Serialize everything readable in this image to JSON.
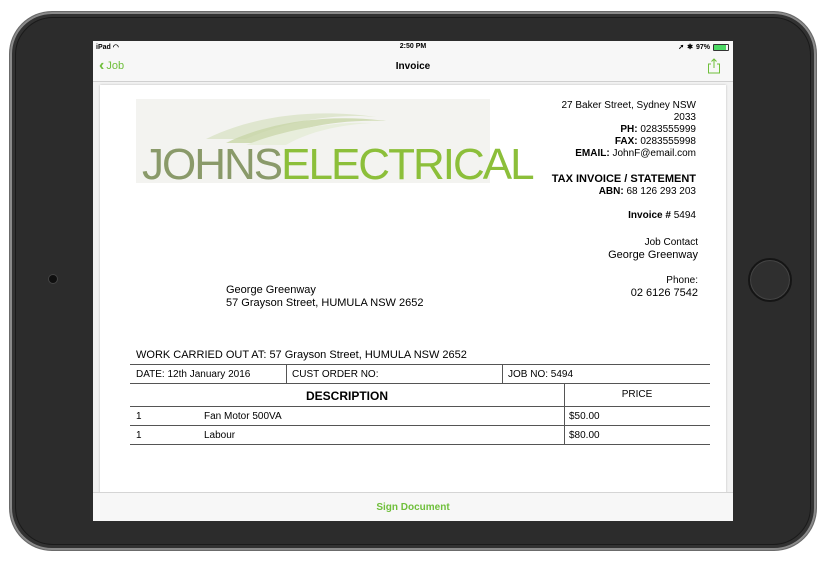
{
  "status_bar": {
    "device": "iPad",
    "time": "2:50 PM",
    "battery": "97%"
  },
  "nav": {
    "back_label": "Job",
    "title": "Invoice"
  },
  "logo": {
    "part1": "JOHNS",
    "part2": "ELECTRICAL",
    "color_part1": "#8a9a6a",
    "color_part2": "#8cbf3a"
  },
  "company": {
    "address_line1": "27 Baker Street, Sydney NSW",
    "address_line2": "2033",
    "ph_label": "PH:",
    "ph": "0283555999",
    "fax_label": "FAX:",
    "fax": "0283555998",
    "email_label": "EMAIL:",
    "email": "JohnF@email.com"
  },
  "invoice": {
    "title": "TAX INVOICE / STATEMENT",
    "abn_label": "ABN:",
    "abn": "68 126 293 203",
    "number_label": "Invoice #",
    "number": "5494",
    "job_contact_label": "Job Contact",
    "job_contact": "George Greenway",
    "phone_label": "Phone:",
    "phone": "02 6126 7542"
  },
  "client": {
    "name": "George Greenway",
    "address": "57 Grayson Street, HUMULA NSW 2652"
  },
  "work_carried_out": "WORK CARRIED OUT AT: 57 Grayson Street, HUMULA NSW 2652",
  "meta_row": {
    "date": "DATE: 12th January 2016",
    "cust_order": "CUST ORDER NO:",
    "job_no": "JOB NO: 5494"
  },
  "table_headers": {
    "description": "DESCRIPTION",
    "price": "PRICE"
  },
  "line_items": [
    {
      "qty": "1",
      "description": "Fan Motor 500VA",
      "price": "$50.00"
    },
    {
      "qty": "1",
      "description": "Labour",
      "price": "$80.00"
    }
  ],
  "footer": {
    "sign_label": "Sign Document"
  },
  "colors": {
    "accent": "#6fbf3b"
  }
}
